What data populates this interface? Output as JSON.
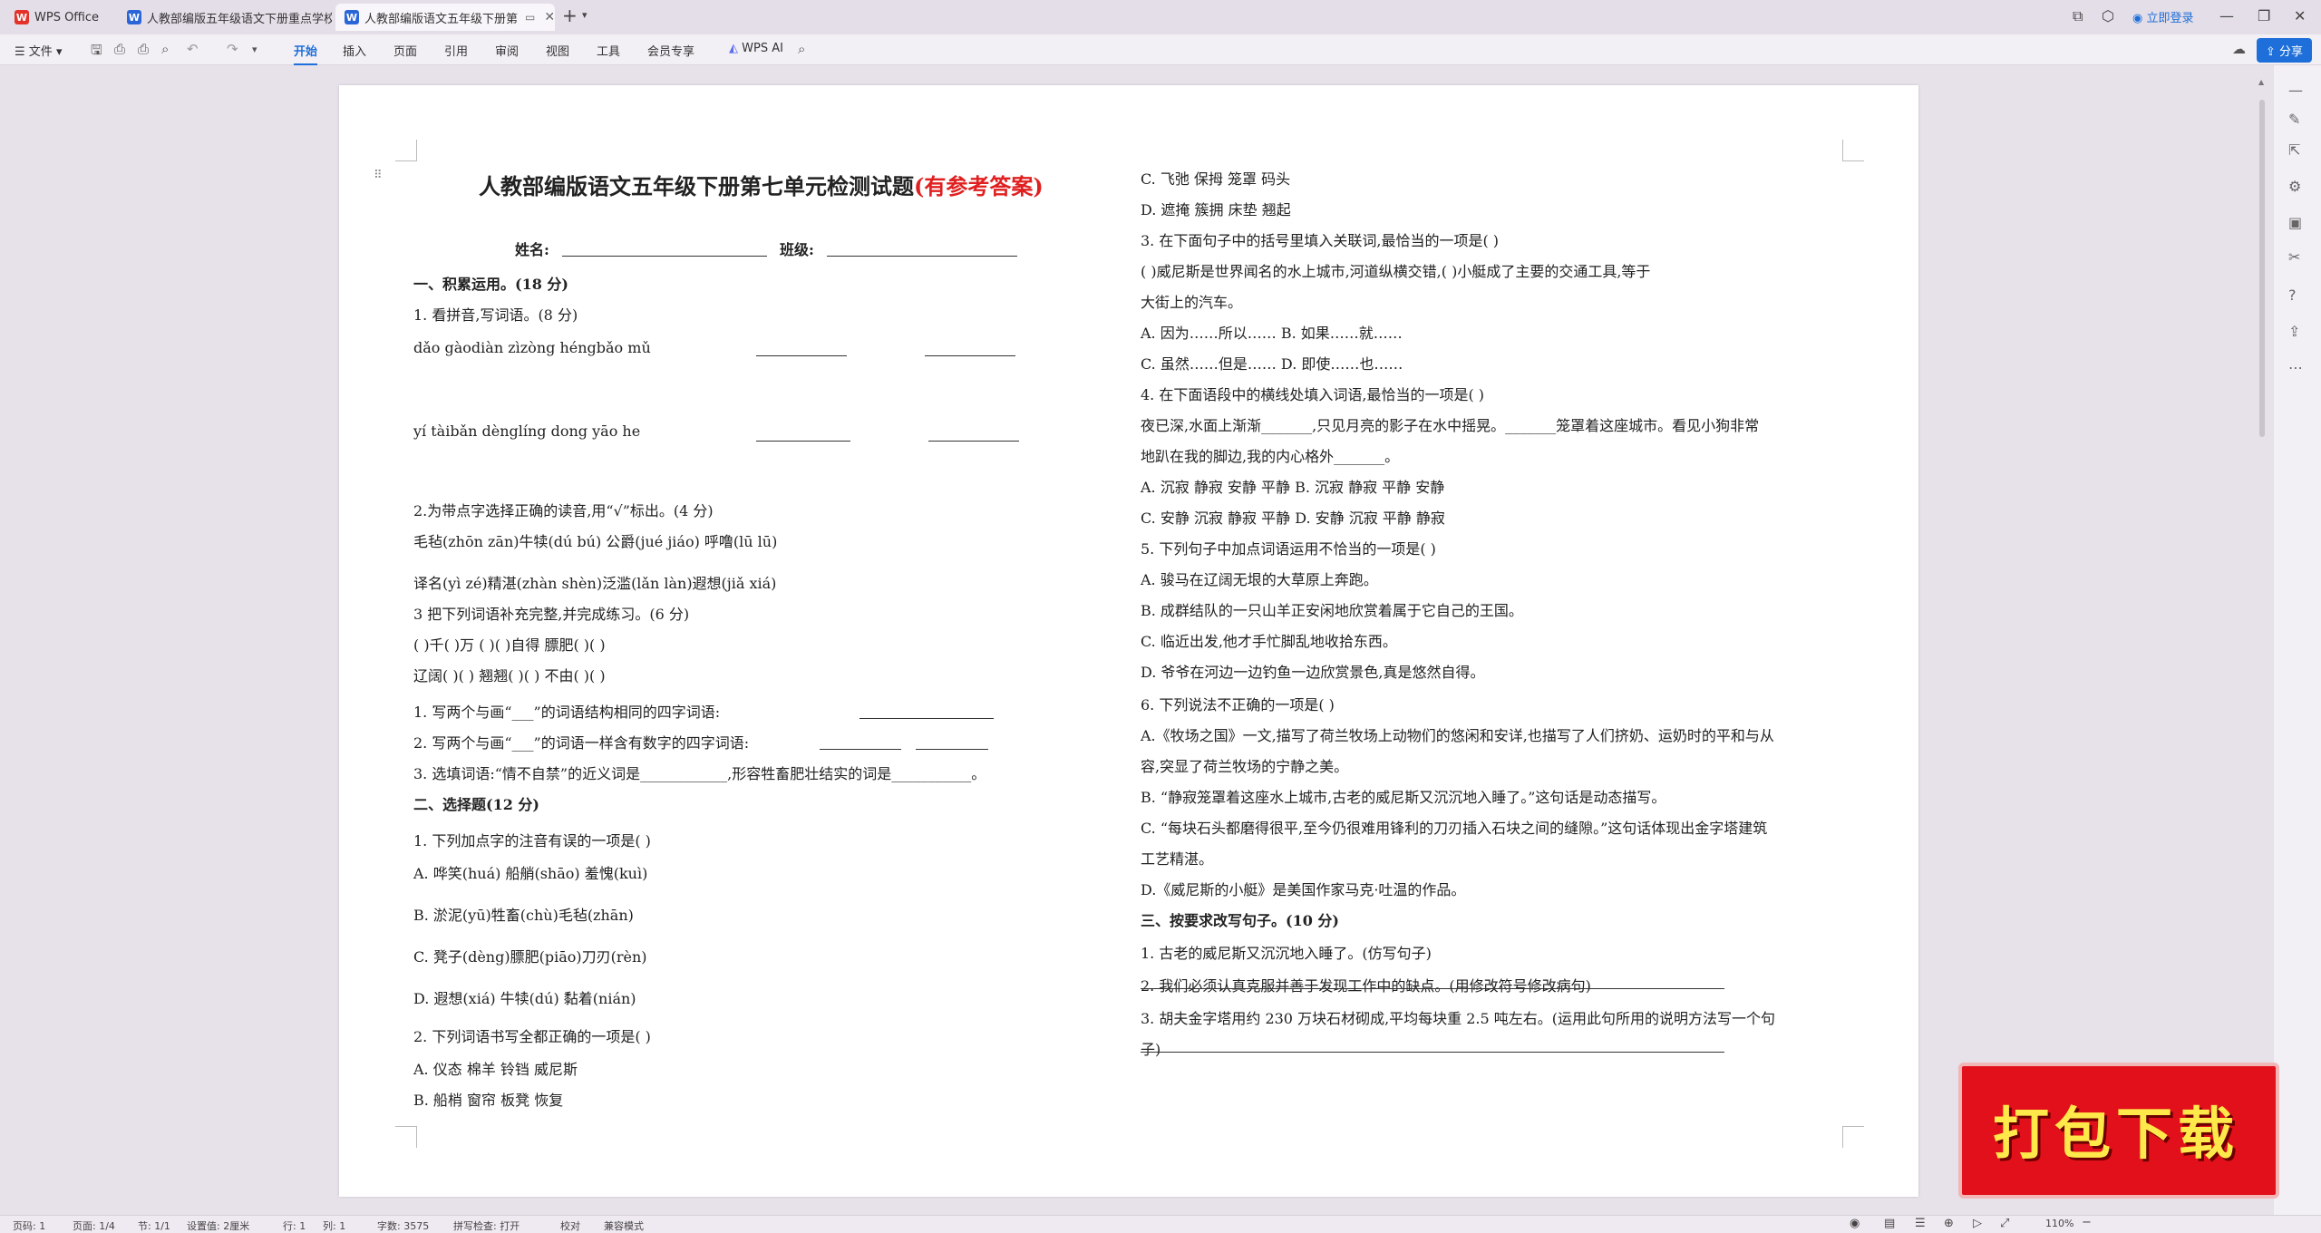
{
  "tabs": [
    {
      "label": "WPS Office",
      "icon": "wps-logo",
      "active": false
    },
    {
      "label": "人教部编版五年级语文下册重点学校",
      "icon": "word-doc",
      "active": false
    },
    {
      "label": "人教部编版语文五年级下册第",
      "icon": "word-doc",
      "active": true
    }
  ],
  "titlebar": {
    "login": "立即登录"
  },
  "toolbar": {
    "file": "文件",
    "menus": [
      "开始",
      "插入",
      "页面",
      "引用",
      "审阅",
      "视图",
      "工具",
      "会员专享"
    ],
    "wps_ai": "WPS AI",
    "share": "分享"
  },
  "document": {
    "title_black": "人教部编版语文五年级下册第七单元检测试题",
    "title_red": "(有参考答案)",
    "name_label": "姓名:",
    "class_label": "班级:",
    "left": [
      {
        "t": "一、积累运用。(18 分)",
        "b": true
      },
      {
        "t": "1. 看拼音,写词语。(8 分)"
      },
      {
        "t": "dǎo gàodiàn  zìzòng héngbǎo  mǔ"
      },
      {
        "t": "yí  tàibǎn  dènglíng dong     yāo he"
      },
      {
        "t": "2.为带点字选择正确的读音,用“√”标出。(4 分)"
      },
      {
        "t": "毛毡(zhōn  zān)牛犊(dú  bú)  公爵(jué  jiáo)   呼噜(lū  lū)"
      },
      {
        "t": "译名(yì  zé)精湛(zhàn  shèn)泛滥(lǎn  làn)遐想(jiǎ  xiá)"
      },
      {
        "t": "3 把下列词语补充完整,并完成练习。(6 分)"
      },
      {
        "t": "(    )千(    )万     (   )(   )自得   膘肥(   )(   )"
      },
      {
        "t": "辽阔(   )(   )        翘翘(   )(   )   不由(   )(   )"
      },
      {
        "t": "1. 写两个与画“___”的词语结构相同的四字词语:"
      },
      {
        "t": "2. 写两个与画“___”的词语一样含有数字的四字词语:"
      },
      {
        "t": "3. 选填词语:“情不自禁”的近义词是____________,形容牲畜肥壮结实的词是___________。"
      },
      {
        "t": "二、选择题(12 分)",
        "b": true
      },
      {
        "t": "1. 下列加点字的注音有误的一项是(   )"
      },
      {
        "t": "A. 哗笑(huá)      船艄(shāo)     羞愧(kuì)"
      },
      {
        "t": "B. 淤泥(yū)牲畜(chù)毛毡(zhān)"
      },
      {
        "t": "C. 凳子(dèng)膘肥(piāo)刀刃(rèn)"
      },
      {
        "t": "D. 遐想(xiá)      牛犊(dú)      黏着(nián)"
      },
      {
        "t": "2. 下列词语书写全都正确的一项是(   )"
      },
      {
        "t": "A. 仪态         棉羊         铃铛         威尼斯"
      },
      {
        "t": "B. 船梢         窗帘         板凳         恢复"
      }
    ],
    "right": [
      {
        "t": "C. 飞弛         保拇         笼罩         码头"
      },
      {
        "t": "D. 遮掩         簇拥         床垫         翘起"
      },
      {
        "t": "3. 在下面句子中的括号里填入关联词,最恰当的一项是(    )"
      },
      {
        "t": "(          )威尼斯是世界闻名的水上城市,河道纵横交错,(          )小艇成了主要的交通工具,等于"
      },
      {
        "t": "大街上的汽车。"
      },
      {
        "t": "A. 因为……所以……               B. 如果……就……"
      },
      {
        "t": "C. 虽然……但是……               D. 即使……也……"
      },
      {
        "t": "4. 在下面语段中的横线处填入词语,最恰当的一项是(    )"
      },
      {
        "t": "夜已深,水面上渐渐_______,只见月亮的影子在水中摇晃。_______笼罩着这座城市。看见小狗非常"
      },
      {
        "t": "地趴在我的脚边,我的内心格外_______。"
      },
      {
        "t": "A. 沉寂  静寂  安静  平静     B. 沉寂  静寂  平静  安静"
      },
      {
        "t": "C. 安静  沉寂  静寂  平静     D. 安静  沉寂  平静  静寂"
      },
      {
        "t": "5. 下列句子中加点词语运用不恰当的一项是(    )"
      },
      {
        "t": "A. 骏马在辽阔无垠的大草原上奔跑。"
      },
      {
        "t": "B. 成群结队的一只山羊正安闲地欣赏着属于它自己的王国。"
      },
      {
        "t": "C. 临近出发,他才手忙脚乱地收拾东西。"
      },
      {
        "t": "D. 爷爷在河边一边钓鱼一边欣赏景色,真是悠然自得。"
      },
      {
        "t": "6. 下列说法不正确的一项是(    )"
      },
      {
        "t": "A.《牧场之国》一文,描写了荷兰牧场上动物们的悠闲和安详,也描写了人们挤奶、运奶时的平和与从"
      },
      {
        "t": "容,突显了荷兰牧场的宁静之美。"
      },
      {
        "t": "B. “静寂笼罩着这座水上城市,古老的威尼斯又沉沉地入睡了。”这句话是动态描写。"
      },
      {
        "t": "C. “每块石头都磨得很平,至今仍很难用锋利的刀刃插入石块之间的缝隙。”这句话体现出金字塔建筑"
      },
      {
        "t": "工艺精湛。"
      },
      {
        "t": "D.《威尼斯的小艇》是美国作家马克·吐温的作品。"
      },
      {
        "t": "三、按要求改写句子。(10 分)",
        "b": true
      },
      {
        "t": "1. 古老的威尼斯又沉沉地入睡了。(仿写句子)"
      },
      {
        "t": "2. 我们必须认真克服并善于发现工作中的缺点。(用修改符号修改病句)"
      },
      {
        "t": "3. 胡夫金字塔用约 230 万块石材砌成,平均每块重 2.5 吨左右。(运用此句所用的说明方法写一个句"
      },
      {
        "t": "子)"
      }
    ]
  },
  "status": {
    "page": "页码: 1",
    "pages": "页面: 1/4",
    "section": "节: 1/1",
    "setting": "设置值: 2厘米",
    "row": "行: 1",
    "col": "列: 1",
    "words": "字数: 3575",
    "spell": "拼写检查: 打开",
    "proof": "校对",
    "compat": "兼容模式",
    "zoom": "110%"
  },
  "banner": {
    "text": "打包下载"
  },
  "colors": {
    "accent": "#1e6fd9",
    "title_red": "#e02020",
    "banner_bg": "#e1101a",
    "banner_text": "#ffe94a"
  }
}
